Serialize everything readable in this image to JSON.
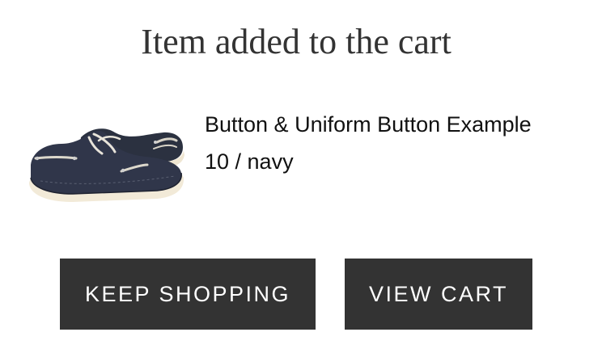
{
  "dialog": {
    "title": "Item added to the cart"
  },
  "product": {
    "name": "Button & Uniform Button Example",
    "variant": "10 / navy",
    "image_icon": "boat-shoe-image"
  },
  "actions": {
    "keep_shopping_label": "KEEP SHOPPING",
    "view_cart_label": "VIEW CART"
  },
  "colors": {
    "button_bg": "#333333",
    "button_text": "#ffffff",
    "shoe_body": "#2e3440",
    "sole": "#f2ead8"
  }
}
